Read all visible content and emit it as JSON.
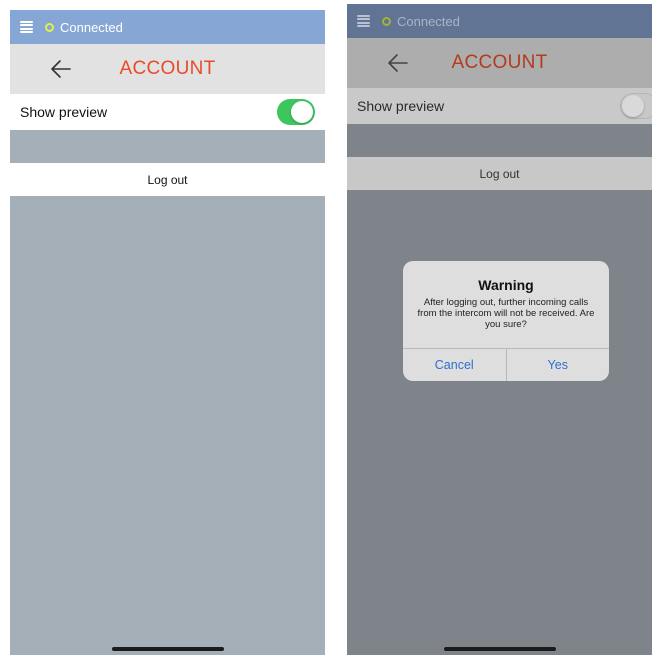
{
  "left_screen": {
    "status": {
      "text": "Connected"
    },
    "header": {
      "title": "ACCOUNT"
    },
    "preview": {
      "label": "Show preview",
      "toggle_on": true
    },
    "logout": {
      "label": "Log out"
    }
  },
  "right_screen": {
    "status": {
      "text": "Connected"
    },
    "header": {
      "title": "ACCOUNT"
    },
    "preview": {
      "label": "Show preview",
      "toggle_on": false
    },
    "logout": {
      "label": "Log out"
    },
    "dialog": {
      "title": "Warning",
      "message": "After logging out, further incoming calls from the intercom will not be received. Are you sure?",
      "cancel_label": "Cancel",
      "confirm_label": "Yes"
    }
  },
  "icons": {
    "menu": "menu-icon",
    "status": "status-dot-icon",
    "back": "back-arrow-icon"
  },
  "colors": {
    "accent_title": "#e94b2a",
    "statusbar": "#86a7d6",
    "toggle_on": "#3ec55d",
    "dialog_button": "#2f6fd0"
  }
}
